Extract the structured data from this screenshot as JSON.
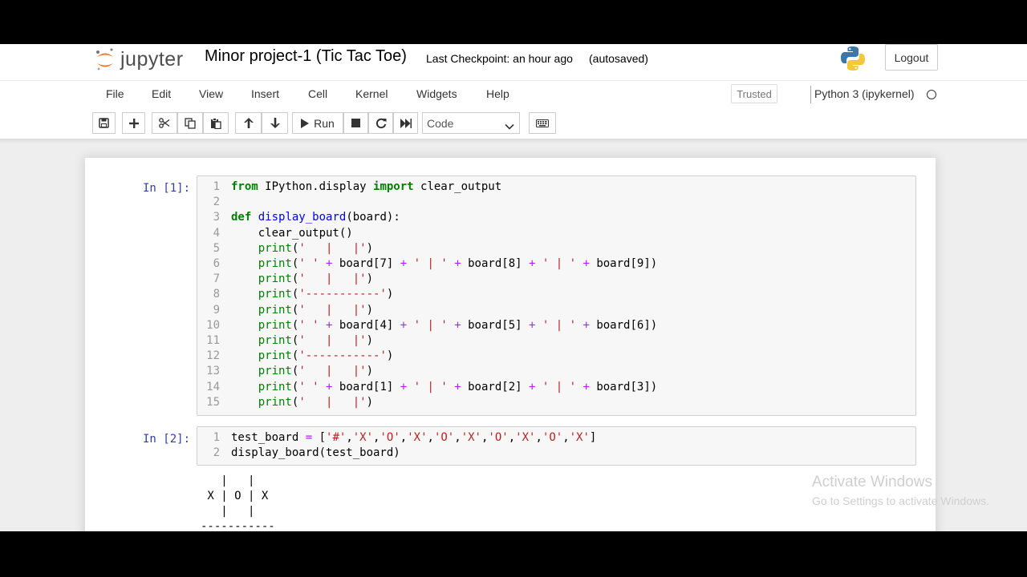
{
  "header": {
    "logo_text": "jupyter",
    "notebook_title": "Minor project-1 (Tic Tac Toe)",
    "checkpoint": "Last Checkpoint: an hour ago",
    "autosave": "(autosaved)",
    "logout_label": "Logout"
  },
  "menubar": {
    "items": [
      "File",
      "Edit",
      "View",
      "Insert",
      "Cell",
      "Kernel",
      "Widgets",
      "Help"
    ],
    "trusted_label": "Trusted",
    "kernel_name": "Python 3 (ipykernel)"
  },
  "toolbar": {
    "run_label": "Run",
    "cell_type": "Code",
    "icons": [
      "save-icon",
      "plus-icon",
      "cut-icon",
      "copy-icon",
      "paste-icon",
      "arrow-up-icon",
      "arrow-down-icon",
      "run-icon",
      "stop-icon",
      "restart-icon",
      "fast-forward-icon",
      "keyboard-icon"
    ]
  },
  "cells": [
    {
      "prompt": "In [1]:",
      "lines": [
        {
          "n": "1",
          "html": "<span class='kw'>from</span> IPython.display <span class='kw'>import</span> clear_output"
        },
        {
          "n": "2",
          "html": ""
        },
        {
          "n": "3",
          "html": "<span class='kw'>def</span> <span class='fn'>display_board</span>(board):"
        },
        {
          "n": "4",
          "html": "    clear_output()"
        },
        {
          "n": "5",
          "html": "    <span class='bi'>print</span>(<span class='st'>'   |   |'</span>)"
        },
        {
          "n": "6",
          "html": "    <span class='bi'>print</span>(<span class='st'>' '</span> <span class='op'>+</span> board[7] <span class='op'>+</span> <span class='st'>' | '</span> <span class='op'>+</span> board[8] <span class='op'>+</span> <span class='st'>' | '</span> <span class='op'>+</span> board[9])"
        },
        {
          "n": "7",
          "html": "    <span class='bi'>print</span>(<span class='st'>'   |   |'</span>)"
        },
        {
          "n": "8",
          "html": "    <span class='bi'>print</span>(<span class='st'>'-----------'</span>)"
        },
        {
          "n": "9",
          "html": "    <span class='bi'>print</span>(<span class='st'>'   |   |'</span>)"
        },
        {
          "n": "10",
          "html": "    <span class='bi'>print</span>(<span class='st'>' '</span> <span class='op'>+</span> board[4] <span class='op'>+</span> <span class='st'>' | '</span> <span class='op'>+</span> board[5] <span class='op'>+</span> <span class='st'>' | '</span> <span class='op'>+</span> board[6])"
        },
        {
          "n": "11",
          "html": "    <span class='bi'>print</span>(<span class='st'>'   |   |'</span>)"
        },
        {
          "n": "12",
          "html": "    <span class='bi'>print</span>(<span class='st'>'-----------'</span>)"
        },
        {
          "n": "13",
          "html": "    <span class='bi'>print</span>(<span class='st'>'   |   |'</span>)"
        },
        {
          "n": "14",
          "html": "    <span class='bi'>print</span>(<span class='st'>' '</span> <span class='op'>+</span> board[1] <span class='op'>+</span> <span class='st'>' | '</span> <span class='op'>+</span> board[2] <span class='op'>+</span> <span class='st'>' | '</span> <span class='op'>+</span> board[3])"
        },
        {
          "n": "15",
          "html": "    <span class='bi'>print</span>(<span class='st'>'   |   |'</span>)"
        }
      ]
    },
    {
      "prompt": "In [2]:",
      "lines": [
        {
          "n": "1",
          "html": "test_board <span class='op'>=</span> [<span class='st'>'#'</span>,<span class='st'>'X'</span>,<span class='st'>'O'</span>,<span class='st'>'X'</span>,<span class='st'>'O'</span>,<span class='st'>'X'</span>,<span class='st'>'O'</span>,<span class='st'>'X'</span>,<span class='st'>'O'</span>,<span class='st'>'X'</span>]"
        },
        {
          "n": "2",
          "html": "display_board(test_board)"
        }
      ]
    }
  ],
  "output_lines": [
    "   |   |",
    " X | O | X",
    "   |   |",
    "-----------"
  ],
  "watermark": {
    "title": "Activate Windows",
    "subtitle": "Go to Settings to activate Windows."
  }
}
